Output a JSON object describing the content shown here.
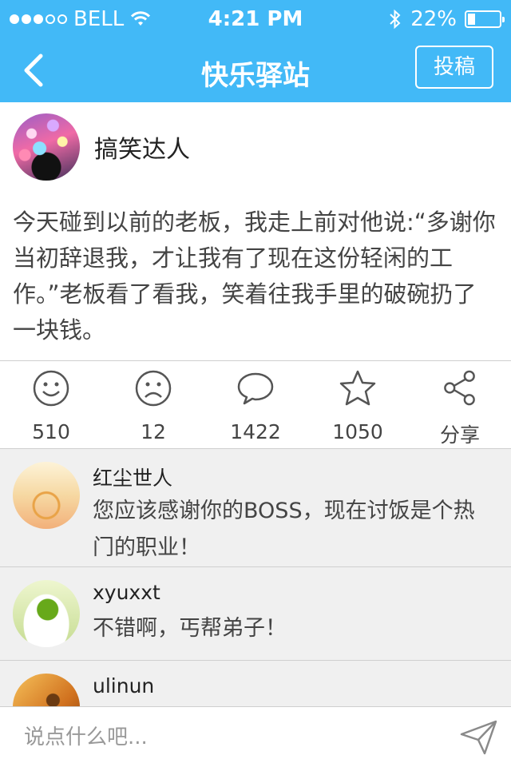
{
  "status_bar": {
    "carrier": "BELL",
    "time": "4:21 PM",
    "battery": "22%",
    "battery_level": 0.22
  },
  "nav": {
    "title": "快乐驿站",
    "submit_label": "投稿",
    "back_icon": "chevron-left-icon"
  },
  "post": {
    "author": "搞笑达人",
    "text": "今天碰到以前的老板，我走上前对他说:“多谢你当初辞退我，才让我有了现在这份轻闲的工作。”老板看了看我，笑着往我手里的破碗扔了一块钱。"
  },
  "actions": [
    {
      "icon": "smile-icon",
      "label": "510"
    },
    {
      "icon": "frown-icon",
      "label": "12"
    },
    {
      "icon": "comment-icon",
      "label": "1422"
    },
    {
      "icon": "star-icon",
      "label": "1050"
    },
    {
      "icon": "share-icon",
      "label": "分享"
    }
  ],
  "comments": [
    {
      "name": "红尘世人",
      "text": "您应该感谢你的BOSS，现在讨饭是个热门的职业！"
    },
    {
      "name": "xyuxxt",
      "text": "不错啊，丐帮弟子！"
    },
    {
      "name": "ulinun",
      "text": ""
    }
  ],
  "input": {
    "placeholder": "说点什么吧...",
    "send_icon": "send-icon"
  },
  "colors": {
    "accent": "#42b9f7",
    "background": "#f0f0f0",
    "text": "#444444"
  }
}
